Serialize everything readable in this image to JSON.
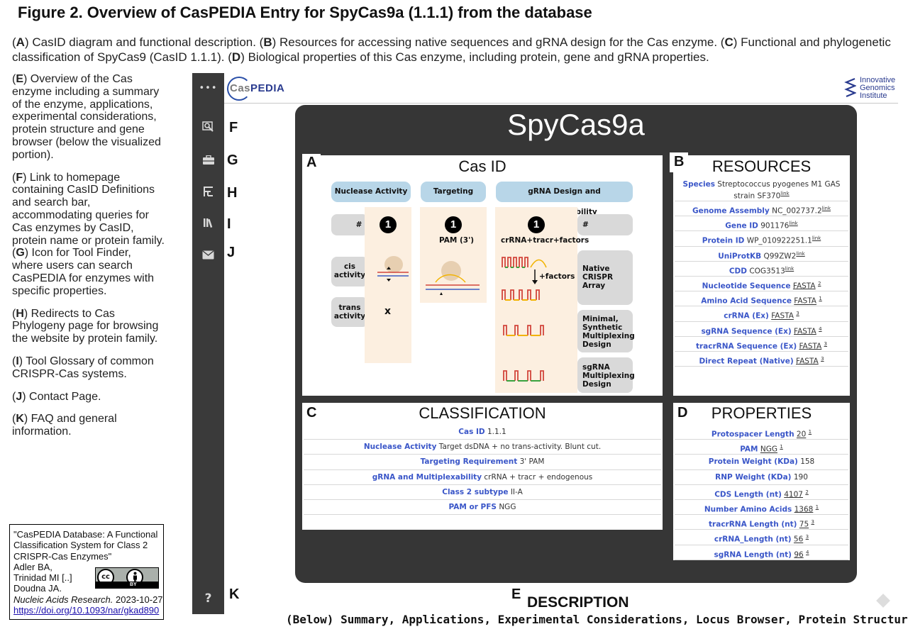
{
  "figure_title": "Figure 2. Overview of CasPEDIA Entry for SpyCas9a (1.1.1) from the database",
  "caption_top": [
    {
      "t": "("
    },
    {
      "t": "A",
      "b": true
    },
    {
      "t": ") CasID diagram and functional description. ("
    },
    {
      "t": "B",
      "b": true
    },
    {
      "t": ") Resources for accessing native sequences and gRNA design for the Cas enzyme. ("
    },
    {
      "t": "C",
      "b": true
    },
    {
      "t": ") Functional and phylogenetic classification of SpyCas9 (CasID 1.1.1). ("
    },
    {
      "t": "D",
      "b": true
    },
    {
      "t": ") Biological properties of this Cas enzyme, including protein, gene and gRNA properties."
    }
  ],
  "left_notes": {
    "e": {
      "letter": "E",
      "text": ") Overview of the Cas enzyme including a summary of the enzyme, applications, experimental considerations, protein structure and gene browser (below the visualized portion)."
    },
    "f": {
      "letter": "F",
      "text": ") Link to homepage containing CasID Definitions and search bar, accommodating queries for Cas enzymes by CasID, protein name or protein family."
    },
    "g": {
      "letter": "G",
      "text": ") Icon for Tool Finder, where users can search CasPEDIA for enzymes with specific properties."
    },
    "h": {
      "letter": "H",
      "text": ") Redirects to Cas Phylogeny page for browsing the website by protein family."
    },
    "i": {
      "letter": "I",
      "text": ") Tool Glossary of common CRISPR-Cas systems."
    },
    "j": {
      "letter": "J",
      "text": ") Contact Page."
    },
    "k": {
      "letter": "K",
      "text": ") FAQ and general information."
    }
  },
  "citation": {
    "l1": "\"CasPEDIA Database: A Functional",
    "l2": "Classification System for Class 2",
    "l3": "CRISPR-Cas Enzymes\"",
    "l4": "Adler BA,",
    "l5": "Trinidad MI [..]",
    "l6": "Doudna JA.",
    "journal": "Nucleic Acids Research.",
    "date": "2023-10-27",
    "doi": "https://doi.org/10.1093/nar/gkad890",
    "cc": "cc",
    "by": "BY"
  },
  "sidebar": {
    "icons": [
      "menu-dots-icon",
      "search-icon",
      "toolbox-icon",
      "tree-icon",
      "library-icon",
      "mail-icon",
      "help-icon"
    ],
    "menu_glyph": "•••",
    "help_glyph": "?",
    "letters": {
      "f": "F",
      "g": "G",
      "h": "H",
      "i": "I",
      "j": "J",
      "k": "K"
    }
  },
  "header": {
    "logo_cas": "Cas",
    "logo_pedia": "PEDIA",
    "igi_l1": "Innovative",
    "igi_l2": "Genomics",
    "igi_l3": "Institute"
  },
  "enzyme_name": "SpyCas9a",
  "casid": {
    "letter": "A",
    "title": "Cas ID",
    "headers": [
      "Nuclease Activity",
      "Targeting Context",
      "gRNA Design and Multiplexability"
    ],
    "hash": "#",
    "hash2": "#",
    "cis": "cis activity",
    "trans": "trans activity",
    "x_mark": "x",
    "num1": "1",
    "num2": "1",
    "num3": "1",
    "pam": "PAM (3')",
    "crrna": "crRNA+tracr+factors",
    "factors": "+factors",
    "native": "Native CRISPR Array",
    "minimal": "Minimal, Synthetic Multiplexing Design",
    "sgrna": "sgRNA Multiplexing Design"
  },
  "resources": {
    "letter": "B",
    "title": "RESOURCES",
    "rows": [
      {
        "k": "Species",
        "v": "Streptococcus pyogenes M1 GAS strain SF370",
        "link": "link"
      },
      {
        "k": "Genome Assembly",
        "v": "NC_002737.2",
        "link": "link"
      },
      {
        "k": "Gene ID",
        "v": "901176",
        "link": "link"
      },
      {
        "k": "Protein ID",
        "v": "WP_010922251.1",
        "link": "link"
      },
      {
        "k": "UniProtKB",
        "v": "Q99ZW2",
        "link": "link"
      },
      {
        "k": "CDD",
        "v": "COG3513",
        "link": "link"
      },
      {
        "k": "Nucleotide Sequence",
        "v": "FASTA",
        "sup": "2"
      },
      {
        "k": "Amino Acid Sequence",
        "v": "FASTA",
        "sup": "1"
      },
      {
        "k": "crRNA (Ex)",
        "v": "FASTA",
        "sup": "3"
      },
      {
        "k": "sgRNA Sequence (Ex)",
        "v": "FASTA",
        "sup": "4"
      },
      {
        "k": "tracrRNA Sequence (Ex)",
        "v": "FASTA",
        "sup": "3"
      },
      {
        "k": "Direct Repeat (Native)",
        "v": "FASTA",
        "sup": "3"
      }
    ]
  },
  "classification": {
    "letter": "C",
    "title": "CLASSIFICATION",
    "rows": [
      {
        "k": "Cas ID",
        "v": "1.1.1"
      },
      {
        "k": "Nuclease Activity",
        "v": "Target dsDNA + no trans-activity. Blunt cut."
      },
      {
        "k": "Targeting Requirement",
        "v": "3' PAM"
      },
      {
        "k": "gRNA and Multiplexability",
        "v": "crRNA + tracr + endogenous"
      },
      {
        "k": "Class 2 subtype",
        "v": "II-A"
      },
      {
        "k": "PAM or PFS",
        "v": "NGG"
      }
    ]
  },
  "properties": {
    "letter": "D",
    "title": "PROPERTIES",
    "rows": [
      {
        "k": "Protospacer Length",
        "v": "20",
        "sup": "1"
      },
      {
        "k": "PAM",
        "v": "NGG",
        "sup": "1"
      },
      {
        "k": "Protein Weight (KDa)",
        "v": "158"
      },
      {
        "k": "RNP Weight (KDa)",
        "v": "190"
      },
      {
        "k": "CDS Length (nt)",
        "v": "4107",
        "sup": "2"
      },
      {
        "k": "Number Amino Acids",
        "v": "1368",
        "sup": "1"
      },
      {
        "k": "tracrRNA Length (nt)",
        "v": "75",
        "sup": "3"
      },
      {
        "k": "crRNA_Length (nt)",
        "v": "56",
        "sup": "3"
      },
      {
        "k": "sgRNA Length (nt)",
        "v": "96",
        "sup": "4"
      }
    ]
  },
  "description": {
    "letter": "E",
    "title": "DESCRIPTION",
    "subtitle": "(Below) Summary, Applications, Experimental Considerations, Locus Browser, Protein Structure"
  }
}
